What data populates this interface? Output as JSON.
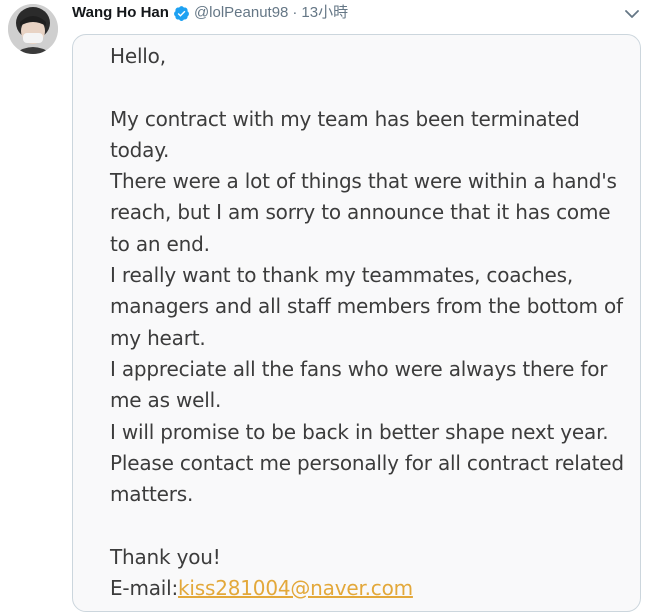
{
  "tweet": {
    "author": {
      "display_name": "Wang Ho Han",
      "handle": "@lolPeanut98",
      "separator": "·",
      "timestamp": "13小時",
      "verified": true
    },
    "icons": {
      "verified": "verified-badge-icon",
      "caret": "chevron-down-icon",
      "avatar": "avatar"
    },
    "colors": {
      "verified": "#1da1f2",
      "link": "#e3a83a",
      "text": "#3c3c3c"
    },
    "letter": {
      "greeting": "Hello,",
      "body": "My contract with my team has been terminated today.\nThere were a lot of things that were within a hand's reach, but I am sorry to announce that it has come to an end.\nI really want to thank my teammates, coaches, managers and all staff members from the bottom of my heart.\nI appreciate all the fans who were always there for me as well.\nI will promise to be back in better shape next year.\nPlease contact me personally for all contract related matters.",
      "closing": "Thank you!",
      "email_label": "E-mail:",
      "email": "kiss281004@naver.com"
    }
  }
}
